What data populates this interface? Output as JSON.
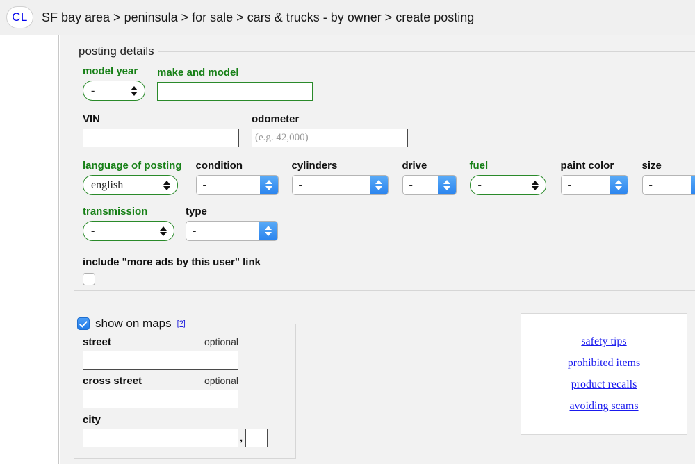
{
  "header": {
    "logo_text": "CL",
    "breadcrumb": "SF bay area > peninsula > for sale > cars & trucks - by owner > create posting"
  },
  "posting_details": {
    "legend": "posting details",
    "model_year": {
      "label": "model year",
      "value": "-"
    },
    "make_and_model": {
      "label": "make and model",
      "value": "",
      "placeholder": ""
    },
    "vin": {
      "label": "VIN",
      "value": "",
      "placeholder": ""
    },
    "odometer": {
      "label": "odometer",
      "value": "",
      "placeholder": "(e.g. 42,000)"
    },
    "language_of_posting": {
      "label": "language of posting",
      "value": "english"
    },
    "condition": {
      "label": "condition",
      "value": "-"
    },
    "cylinders": {
      "label": "cylinders",
      "value": "-"
    },
    "drive": {
      "label": "drive",
      "value": "-"
    },
    "fuel": {
      "label": "fuel",
      "value": "-"
    },
    "paint_color": {
      "label": "paint color",
      "value": "-"
    },
    "size": {
      "label": "size",
      "value": "-"
    },
    "transmission": {
      "label": "transmission",
      "value": "-"
    },
    "type": {
      "label": "type",
      "value": "-"
    },
    "more_ads": {
      "label": "include \"more ads by this user\" link",
      "checked": false
    }
  },
  "show_on_maps": {
    "legend": "show on maps",
    "help_marker": "[?]",
    "checked": true,
    "street": {
      "label": "street",
      "optional": "optional",
      "value": ""
    },
    "cross_street": {
      "label": "cross street",
      "optional": "optional",
      "value": ""
    },
    "city": {
      "label": "city",
      "value": ""
    },
    "comma": ",",
    "state": {
      "value": ""
    }
  },
  "links": [
    {
      "label": "safety tips"
    },
    {
      "label": "prohibited items"
    },
    {
      "label": "product recalls"
    },
    {
      "label": "avoiding scams"
    }
  ],
  "colors": {
    "accent_green": "#178017",
    "link_blue": "#1a1aee",
    "logo_blue": "#0000ee",
    "page_bg": "#f2f2f2"
  }
}
